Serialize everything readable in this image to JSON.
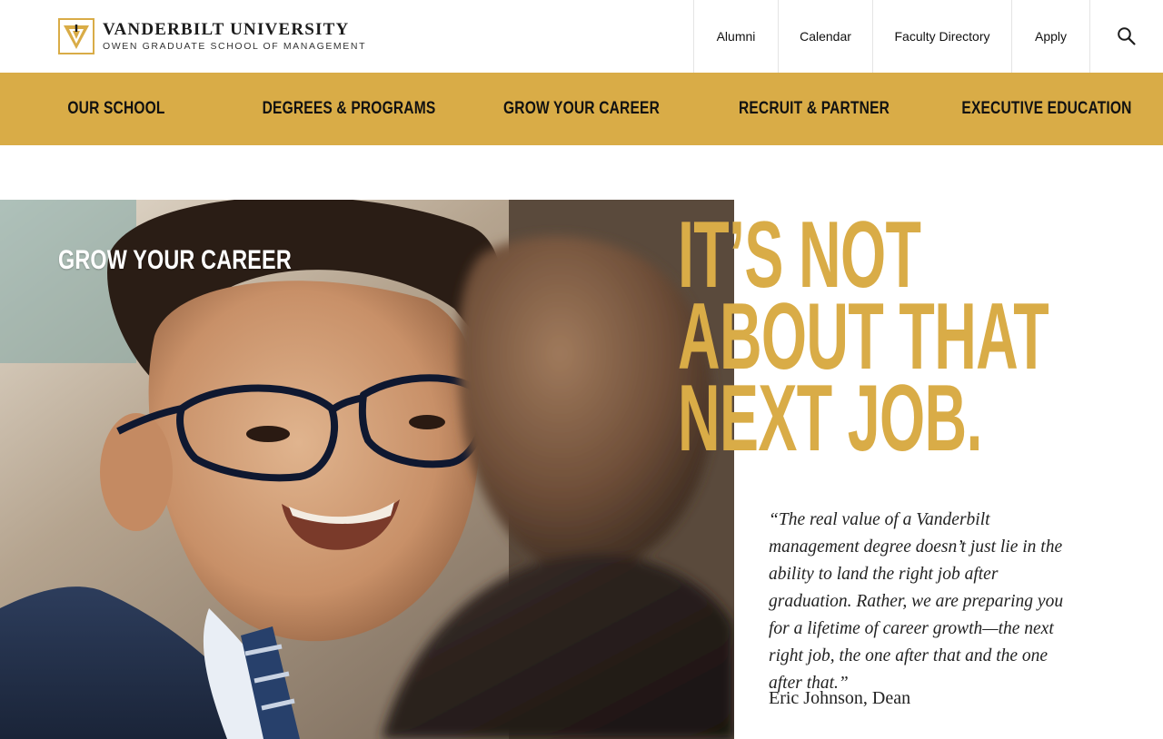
{
  "header": {
    "logo": {
      "university": "VANDERBILT UNIVERSITY",
      "school": "OWEN GRADUATE SCHOOL OF MANAGEMENT",
      "brand_color": "#d9ac47"
    },
    "utility_nav": [
      {
        "label": "Alumni"
      },
      {
        "label": "Calendar"
      },
      {
        "label": "Faculty Directory"
      },
      {
        "label": "Apply"
      }
    ],
    "search_icon": "search-icon"
  },
  "main_nav": {
    "background": "#d9ac47",
    "items": [
      {
        "label": "OUR SCHOOL"
      },
      {
        "label": "DEGREES & PROGRAMS"
      },
      {
        "label": "GROW YOUR CAREER"
      },
      {
        "label": "RECRUIT & PARTNER"
      },
      {
        "label": "EXECUTIVE EDUCATION"
      }
    ]
  },
  "hero": {
    "section_label": "GROW YOUR CAREER",
    "headline_lines": [
      "IT’S NOT",
      "ABOUT THAT",
      "NEXT JOB."
    ],
    "quote": "“The real value of a Vanderbilt management degree doesn’t just lie in the ability to land the right job after graduation. Rather, we are preparing you for a lifetime of career growth—the next right job, the one after that and the one after that.”",
    "attribution": "Eric Johnson, Dean",
    "accent_color": "#d9ac47"
  }
}
